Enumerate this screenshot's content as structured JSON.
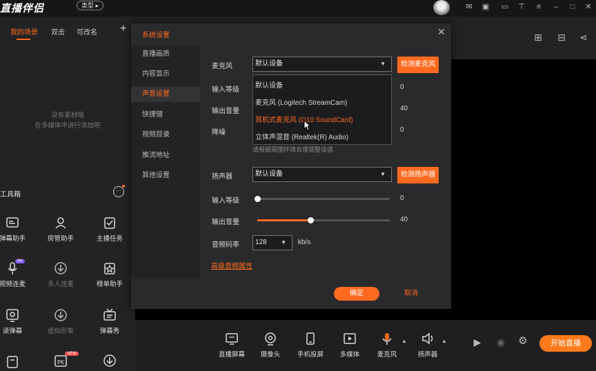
{
  "app": {
    "logo_text": "直播伴侣",
    "type_pill": "类型 ▸"
  },
  "left_panel": {
    "tabs": [
      "我的场景",
      "双击",
      "可改名"
    ],
    "empty_line1": "没有素材哦",
    "empty_line2": "在多媒体中进行添加吧",
    "toolbox_title": "工具箱",
    "tools": [
      {
        "label": "弹幕助手",
        "icon": "danmaku-helper-icon"
      },
      {
        "label": "房管助手",
        "icon": "room-manager-icon"
      },
      {
        "label": "主播任务",
        "icon": "task-icon"
      },
      {
        "label": "视频连麦",
        "icon": "video-mic-icon",
        "badge": "PK"
      },
      {
        "label": "多人连麦",
        "icon": "download-icon"
      },
      {
        "label": "榜单助手",
        "icon": "ranking-icon"
      },
      {
        "label": "读弹幕",
        "icon": "read-danmaku-icon"
      },
      {
        "label": "虚拟形象",
        "icon": "download-icon"
      },
      {
        "label": "弹幕秀",
        "icon": "tv-icon"
      },
      {
        "label": "",
        "icon": "tool-icon"
      },
      {
        "label": "",
        "icon": "pk-icon",
        "badge": "NEW"
      },
      {
        "label": "",
        "icon": "download-icon"
      }
    ]
  },
  "dialog": {
    "title": "系统设置",
    "nav": [
      "直播画质",
      "内容显示",
      "声音设置",
      "快捷键",
      "视频目录",
      "推流地址",
      "其他设置"
    ],
    "active_nav": "声音设置",
    "mic": {
      "label": "麦克风",
      "value": "默认设备",
      "detect_button": "检测麦克风",
      "options": [
        "默认设备",
        "麦克风 (Logitech StreamCam)",
        "耳机式麦克风 (G10 SoundCard)",
        "立体声混音 (Realtek(R) Audio)"
      ],
      "hovered_option": "耳机式麦克风 (G10 SoundCard)"
    },
    "mic_input_level": {
      "label": "输入等级",
      "value": "0"
    },
    "mic_output_volume": {
      "label": "输出音量",
      "value": "40"
    },
    "noise": {
      "label": "降噪",
      "value": "0"
    },
    "hint": "请根据周围环境合理调整该值",
    "speaker": {
      "label": "扬声器",
      "value": "默认设备",
      "detect_button": "检测扬声器"
    },
    "speaker_input_level": {
      "label": "输入等级",
      "value": "0",
      "fraction": 0
    },
    "speaker_output_volume": {
      "label": "输出音量",
      "value": "40",
      "fraction": 0.4
    },
    "bitrate": {
      "label": "音频码率",
      "value": "128",
      "unit": "kb/s"
    },
    "advanced_link": "高级音频属性",
    "ok": "确定",
    "cancel": "取消"
  },
  "bottom_bar": {
    "items": [
      "直播屏幕",
      "摄像头",
      "手机投屏",
      "多媒体",
      "麦克风",
      "扬声器"
    ],
    "start_live": "开始直播"
  }
}
